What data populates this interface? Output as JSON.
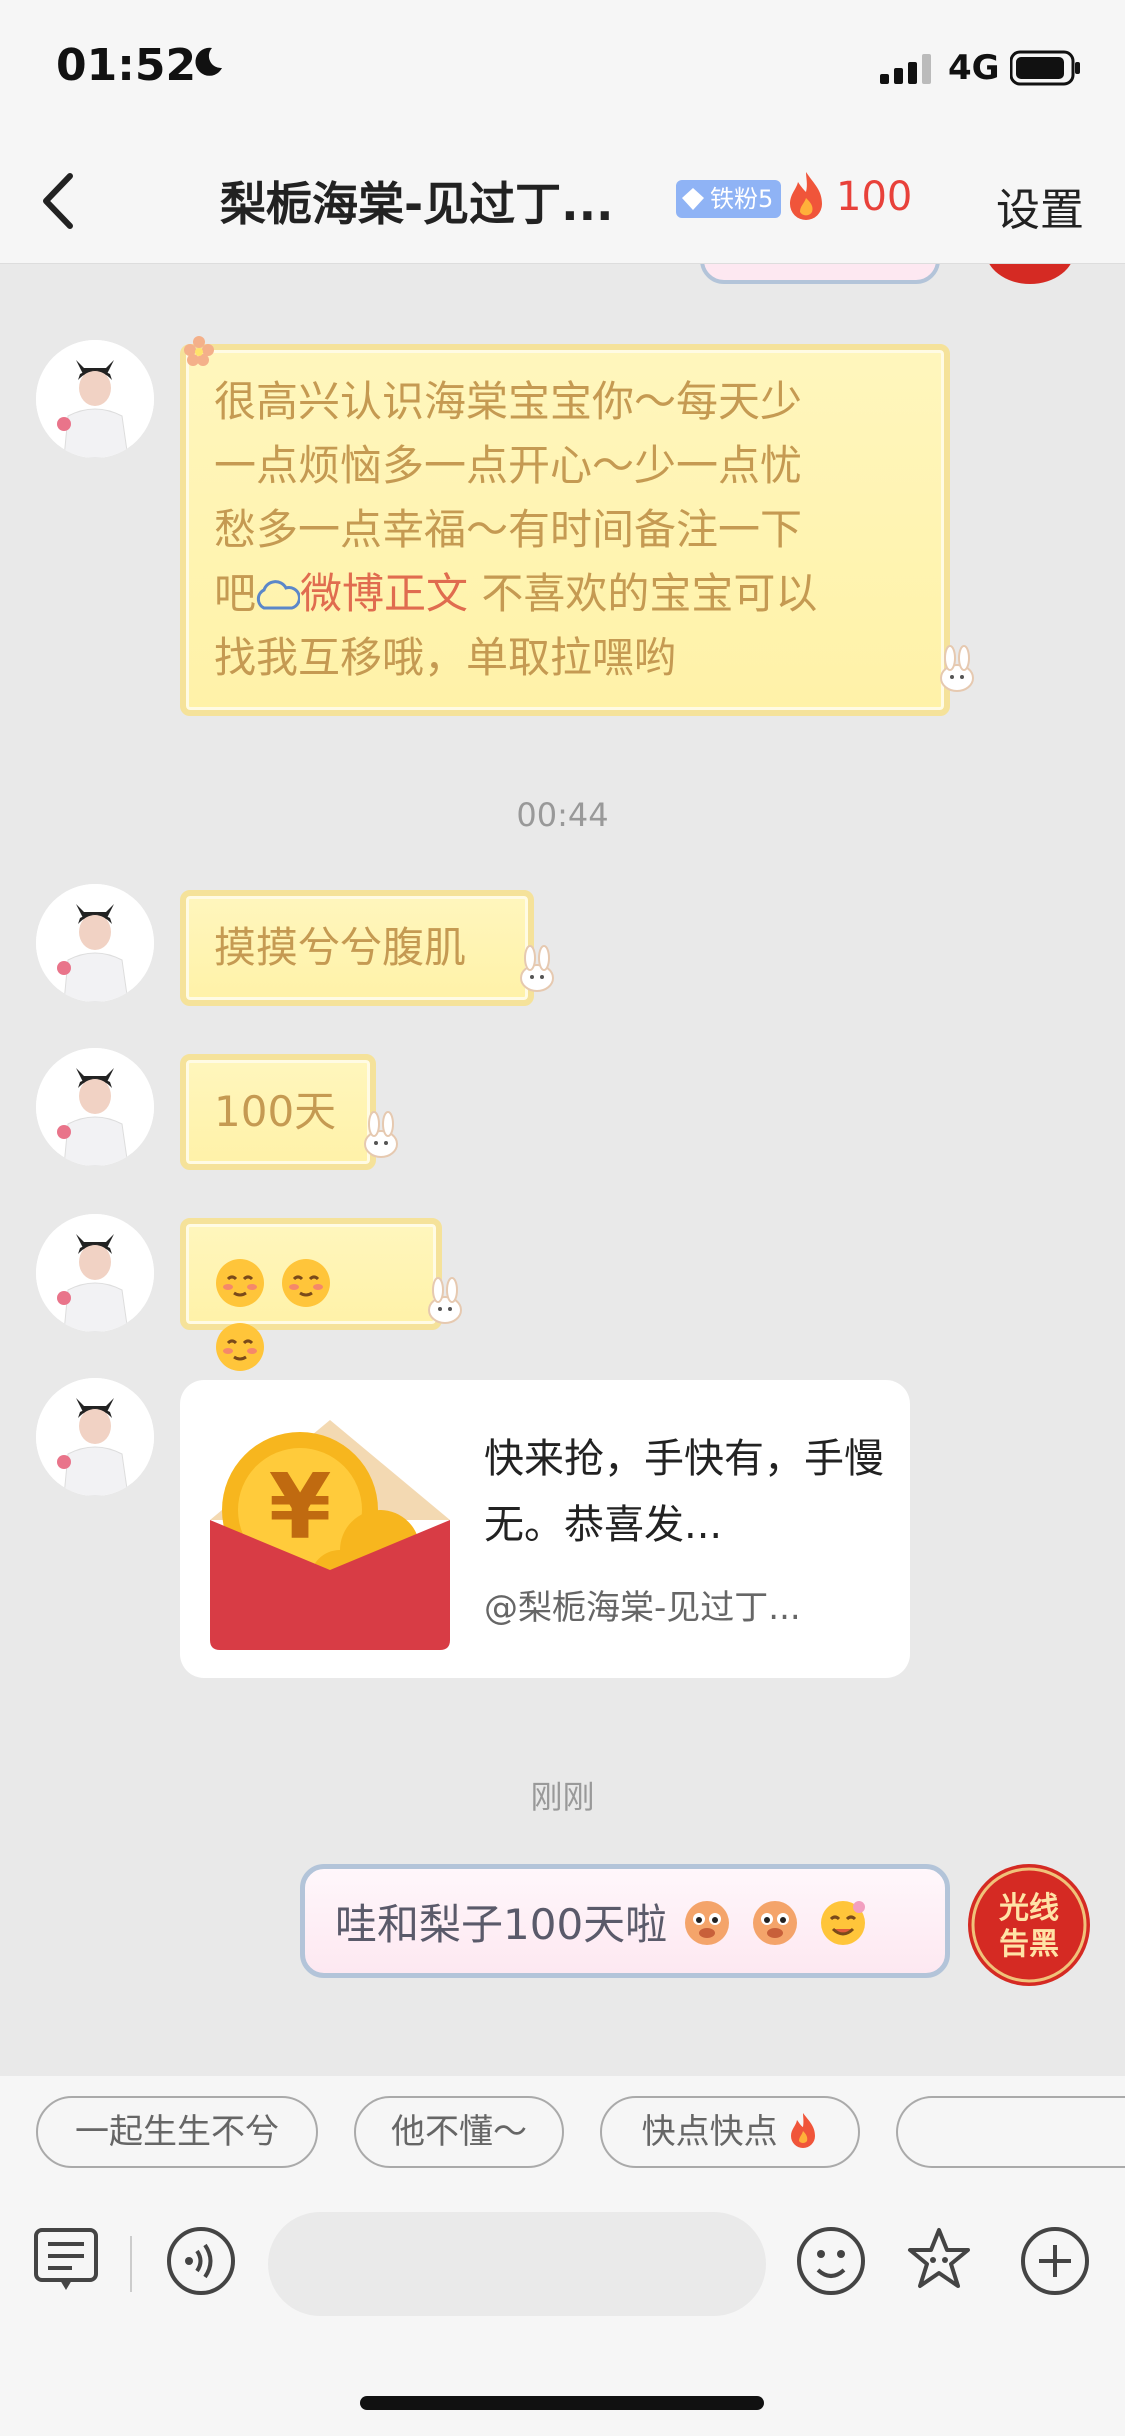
{
  "status_bar": {
    "time": "01:52",
    "network": "4G"
  },
  "header": {
    "back_label": "<",
    "title": "梨栀海棠-见过丁...",
    "fan_badge": "铁粉5",
    "fire_count": "100",
    "settings": "设置"
  },
  "messages": {
    "m1": {
      "line1": "很高兴认识海棠宝宝你～每天少",
      "line2": "一点烦恼多一点开心～少一点忧",
      "line3": "愁多一点幸福～有时间备注一下",
      "line4_prefix": "吧",
      "line4_link": "微博正文",
      "line4_suffix": " 不喜欢的宝宝可以",
      "line5": "找我互移哦，单取拉嘿哟"
    },
    "time1": "00:44",
    "m2": "摸摸兮兮腹肌",
    "m3": "100天",
    "m5": {
      "text": "快来抢，手快有，手慢无。恭喜发...",
      "from": "@梨栀海棠-见过丁..."
    },
    "time2": "刚刚",
    "m6": "哇和梨子100天啦",
    "me_avatar_text": "光线告黑"
  },
  "quick_replies": [
    "一起生生不兮",
    "他不懂～",
    "快点快点"
  ],
  "icons": {
    "back": "chevron-left-icon",
    "fan": "diamond-icon",
    "fire": "fire-icon",
    "keyboard": "keyboard-icon",
    "voice": "voice-icon",
    "emoji": "emoji-icon",
    "sticker": "flower-icon",
    "add": "plus-icon"
  },
  "colors": {
    "fire": "#e8413a",
    "fan_badge": "#8fb3f5",
    "gold_text": "#c59a52",
    "red_packet": "#d83c45"
  }
}
